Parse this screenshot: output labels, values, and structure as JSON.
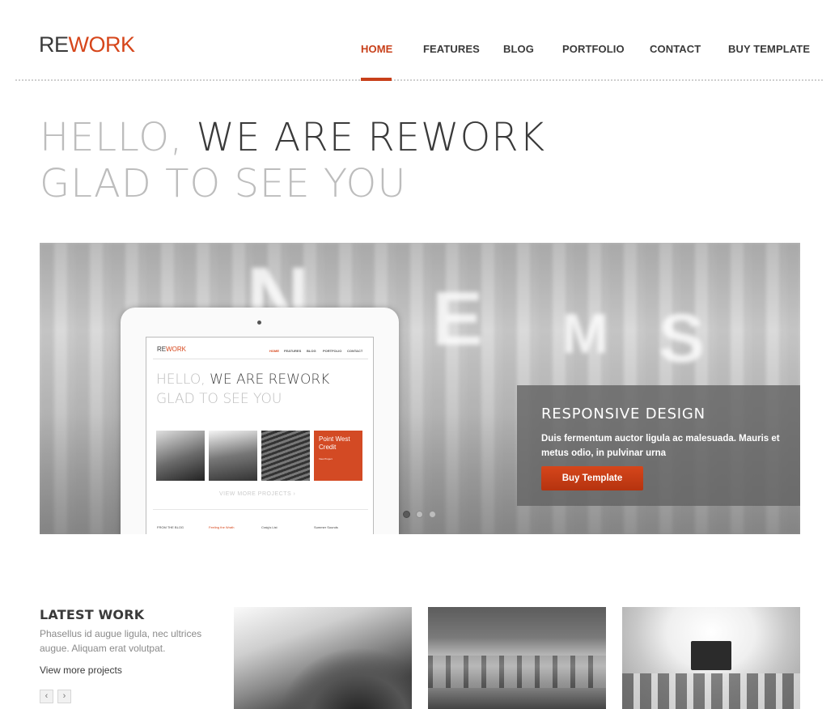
{
  "header": {
    "logo_re": "RE",
    "logo_work": "WORK",
    "nav": [
      "HOME",
      "FEATURES",
      "BLOG",
      "PORTFOLIO",
      "CONTACT",
      "BUY TEMPLATE"
    ],
    "active_nav": "HOME"
  },
  "hero": {
    "line1_light": "HELLO,",
    "line1_dark": "WE ARE REWORK",
    "line2": "GLAD TO SEE YOU"
  },
  "slider": {
    "caption_title": "RESPONSIVE DESIGN",
    "caption_text": "Duis fermentum auctor ligula ac malesuada. Mauris et metus odio, in pulvinar urna",
    "button_label": "Buy Template",
    "dots": 3,
    "active_dot": 1,
    "tablet": {
      "logo_re": "RE",
      "logo_work": "WORK",
      "nav": [
        "HOME",
        "FEATURES",
        "BLOG",
        "PORTFOLIO",
        "CONTACT"
      ],
      "hero_line1_light": "HELLO,",
      "hero_line1_dark": "WE ARE REWORK",
      "hero_line2": "GLAD TO SEE YOU",
      "tile_title": "Point West Credit",
      "tile_sub": "View Project",
      "more": "VIEW MORE PROJECTS ›",
      "footer": [
        "FROM THE BLOG",
        "Feeling the Wrath",
        "Craig's List",
        "Summer Sounds"
      ]
    }
  },
  "latest_work": {
    "title": "LATEST WORK",
    "description": "Phasellus id augue ligula, nec ultrices augue. Aliquam erat volutpat.",
    "link": "View more projects",
    "prev": "‹",
    "next": "›"
  },
  "colors": {
    "accent": "#d6461b",
    "text_dark": "#3a3a3a",
    "text_light": "#bdbdbd"
  }
}
